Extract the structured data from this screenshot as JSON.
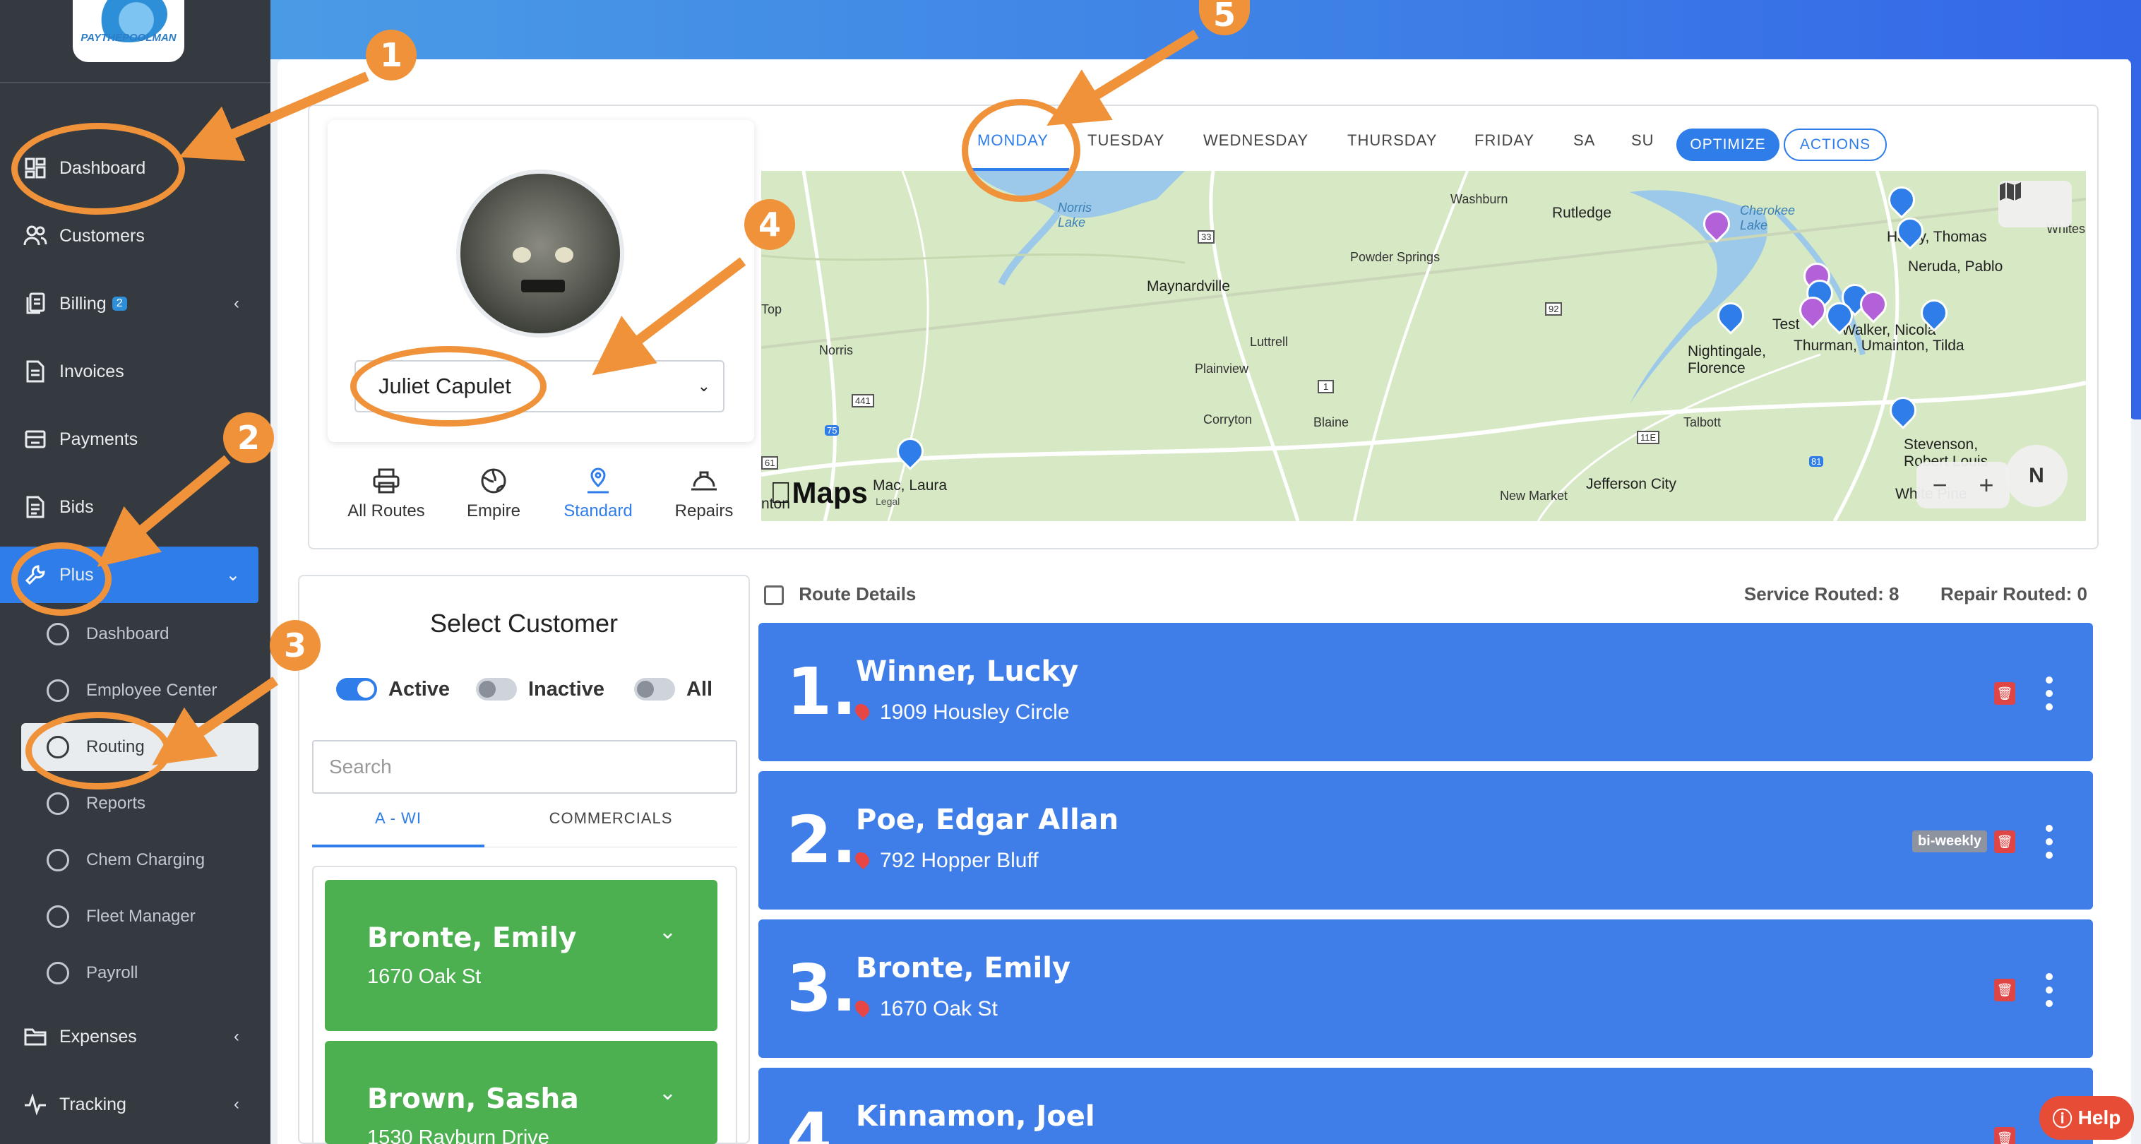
{
  "sidebar": {
    "logo_text": "PAYTHEPOOLMAN",
    "nav": {
      "dashboard": "Dashboard",
      "customers": "Customers",
      "billing": "Billing",
      "billing_badge": "2",
      "invoices": "Invoices",
      "payments": "Payments",
      "bids": "Bids",
      "plus": "Plus",
      "expenses": "Expenses",
      "tracking": "Tracking"
    },
    "plus_sub": {
      "dashboard": "Dashboard",
      "employee_center": "Employee Center",
      "routing": "Routing",
      "reports": "Reports",
      "chem_charging": "Chem Charging",
      "fleet_manager": "Fleet Manager",
      "payroll": "Payroll"
    }
  },
  "employee": {
    "selected": "Juliet Capulet"
  },
  "route_types": {
    "all_routes": "All Routes",
    "empire": "Empire",
    "standard": "Standard",
    "repairs": "Repairs",
    "active": "Standard"
  },
  "days": {
    "monday": "MONDAY",
    "tuesday": "TUESDAY",
    "wednesday": "WEDNESDAY",
    "thursday": "THURSDAY",
    "friday": "FRIDAY",
    "sa": "SA",
    "su": "SU",
    "active": "MONDAY"
  },
  "buttons": {
    "optimize": "OPTIMIZE",
    "actions": "ACTIONS",
    "help": "Help"
  },
  "map": {
    "attribution": "Maps",
    "legal": "Legal",
    "compass": "N",
    "zoom_out": "−",
    "zoom_in": "+",
    "labels": {
      "norris_lake": "Norris\nLake",
      "washburn": "Washburn",
      "rutledge": "Rutledge",
      "cherokee_lake": "Cherokee\nLake",
      "hardy_thomas": "Hardy, Thomas",
      "whites": "Whites",
      "neruda": "Neruda, Pablo",
      "top": "Top",
      "maynardville": "Maynardville",
      "powder_springs": "Powder Springs",
      "luttrell": "Luttrell",
      "norris": "Norris",
      "plainview": "Plainview",
      "test": "Test",
      "walker_nicola": "Walker, Nicola",
      "nightingale": "Nightingale,\nFlorence",
      "thurman": "Thurman, Umainton, Tilda",
      "corryton": "Corryton",
      "blaine": "Blaine",
      "talbott": "Talbott",
      "stevenson": "Stevenson,\nRobert Louis",
      "mac_laura": "Mac, Laura",
      "jefferson_city": "Jefferson City",
      "new_market": "New Market",
      "white_pine": "White Pine",
      "nton": "nton",
      "r33": "33",
      "r92": "92",
      "r1": "1",
      "r441": "441",
      "r75": "75",
      "r11e": "11E",
      "r61": "61",
      "r81": "81"
    }
  },
  "customers": {
    "title": "Select Customer",
    "toggle_active": "Active",
    "toggle_inactive": "Inactive",
    "toggle_all": "All",
    "search_placeholder": "Search",
    "tab_awi": "A - WI",
    "tab_commercials": "COMMERCIALS",
    "list": [
      {
        "name": "Bronte, Emily",
        "address": "1670 Oak St"
      },
      {
        "name": "Brown, Sasha",
        "address": "1530 Rayburn Drive"
      }
    ]
  },
  "route": {
    "header": "Route Details",
    "service_routed": "Service Routed: 8",
    "repair_routed": "Repair Routed: 0",
    "stops": [
      {
        "num": "1.",
        "name": "Winner, Lucky",
        "address": "1909 Housley Circle",
        "tag": ""
      },
      {
        "num": "2.",
        "name": "Poe, Edgar Allan",
        "address": "792 Hopper Bluff",
        "tag": "bi-weekly"
      },
      {
        "num": "3.",
        "name": "Bronte, Emily",
        "address": "1670 Oak St",
        "tag": ""
      },
      {
        "num": "4.",
        "name": "Kinnamon, Joel",
        "address": "",
        "tag": ""
      }
    ]
  },
  "annotations": {
    "n1": "1",
    "n2": "2",
    "n3": "3",
    "n4": "4",
    "n5": "5"
  },
  "colors": {
    "accent": "#2e7de9",
    "sidebar": "#343a40",
    "annotation": "#f0923a",
    "customer_card": "#4caf50",
    "stop_card": "#3f7ee8"
  }
}
